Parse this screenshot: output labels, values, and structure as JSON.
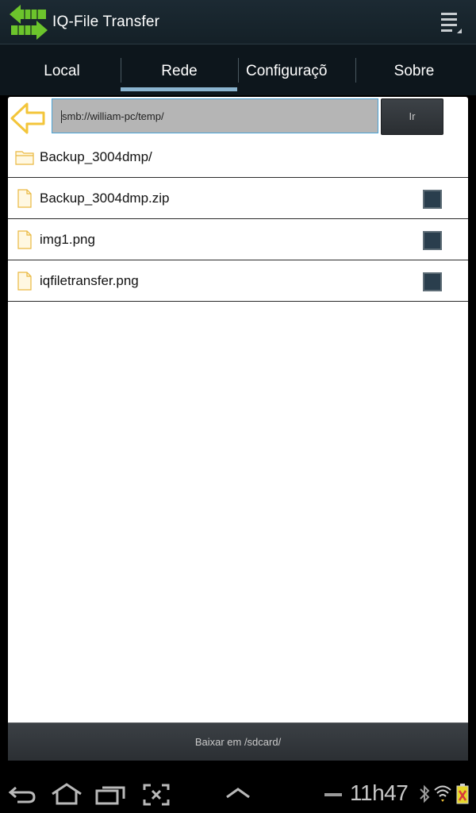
{
  "app": {
    "title": "IQ-File Transfer",
    "logo_icon": "transfer-arrows-icon",
    "menu_icon": "overflow-menu-icon"
  },
  "tabs": [
    {
      "label": "Local",
      "selected": false
    },
    {
      "label": "Rede",
      "selected": true
    },
    {
      "label": "Configuraçõ",
      "selected": false
    },
    {
      "label": "Sobre",
      "selected": false
    }
  ],
  "address_bar": {
    "back_icon": "back-arrow-icon",
    "value": "smb://william-pc/temp/",
    "go_label": "Ir"
  },
  "files": [
    {
      "name": "Backup_3004dmp/",
      "type": "folder",
      "icon": "folder-icon",
      "checkbox": false
    },
    {
      "name": "Backup_3004dmp.zip",
      "type": "file",
      "icon": "file-icon",
      "checkbox": true,
      "checked": false
    },
    {
      "name": "img1.png",
      "type": "file",
      "icon": "file-icon",
      "checkbox": true,
      "checked": false
    },
    {
      "name": "iqfiletransfer.png",
      "type": "file",
      "icon": "file-icon",
      "checkbox": true,
      "checked": false
    }
  ],
  "download_button": {
    "label": "Baixar em /sdcard/"
  },
  "system_bar": {
    "time": "11h47",
    "icons": [
      "back-icon",
      "home-icon",
      "recent-apps-icon",
      "screenshot-icon",
      "up-chevron-icon",
      "minus-icon",
      "bluetooth-icon",
      "wifi-icon",
      "battery-icon"
    ]
  },
  "colors": {
    "accent": "#8ab4cf",
    "logo_green": "#6cc42c",
    "folder_yellow": "#f2c94c",
    "back_arrow_yellow": "#f3c53a"
  }
}
